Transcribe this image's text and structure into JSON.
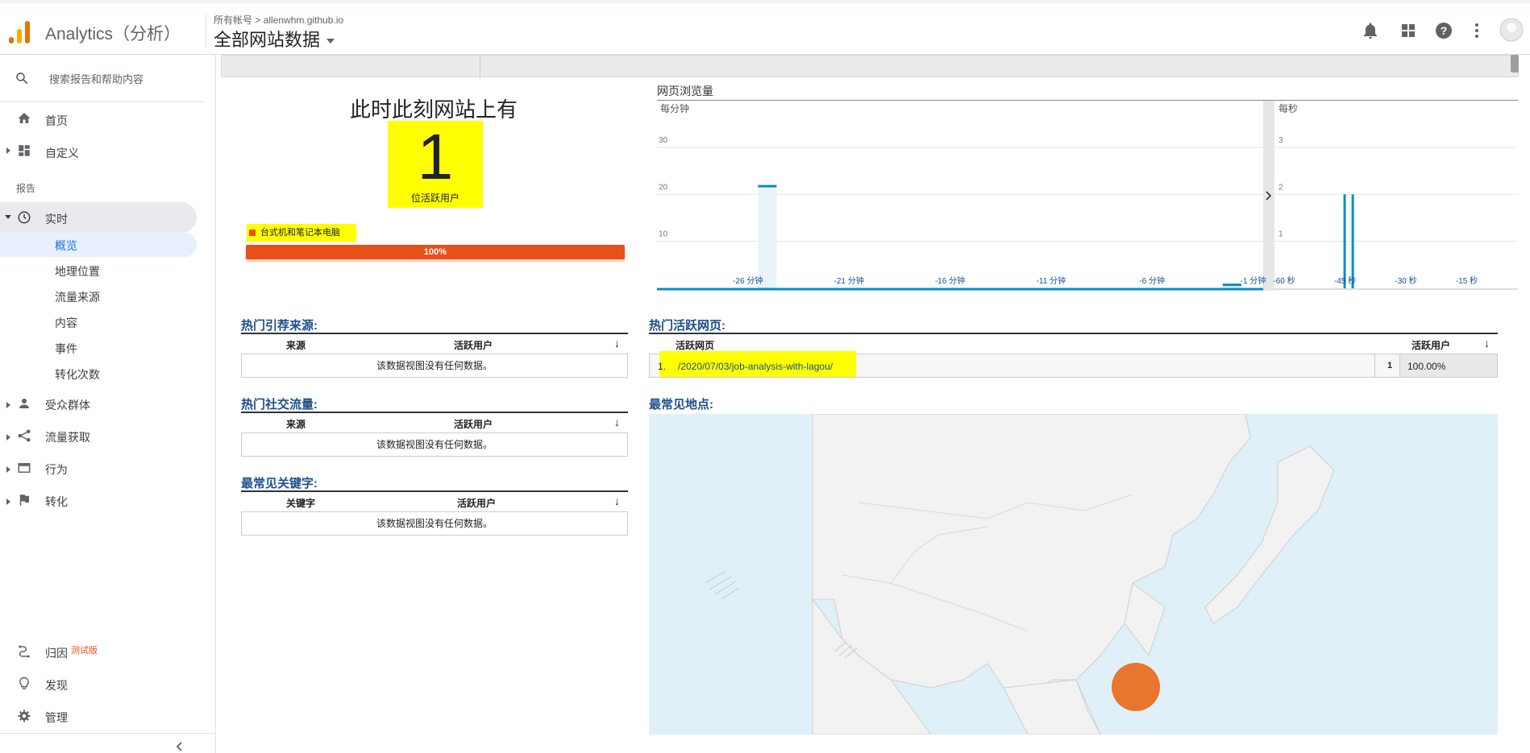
{
  "header": {
    "app_title": "Analytics（分析）",
    "breadcrumb": "所有帐号 > allenwhm.github.io",
    "property": "全部网站数据",
    "icons": [
      "bell-icon",
      "apps-icon",
      "help-icon",
      "more-vert-icon",
      "avatar"
    ]
  },
  "sidebar": {
    "search_placeholder": "搜索报告和帮助内容",
    "home": "首页",
    "customize": "自定义",
    "reports_heading": "报告",
    "realtime": "实时",
    "realtime_items": [
      "概览",
      "地理位置",
      "流量来源",
      "内容",
      "事件",
      "转化次数"
    ],
    "audience": "受众群体",
    "acquisition": "流量获取",
    "behavior": "行为",
    "conversions": "转化",
    "attribution": "归因",
    "beta_badge": "测试版",
    "discover": "发现",
    "admin": "管理",
    "collapse_icon": "chevron-left-icon"
  },
  "overview": {
    "title": "此时此刻网站上有",
    "active_count": "1",
    "active_label": "位活跃用户",
    "device_legend": "台式机和笔记本电脑",
    "device_percent": "100%",
    "device_percent_value": 100,
    "device_color": "#e8501a"
  },
  "pageviews_chart": {
    "title": "网页浏览量",
    "per_minute_label": "每分钟",
    "per_second_label": "每秒",
    "expand_icon": "chevron-right-icon"
  },
  "chart_data": [
    {
      "type": "bar",
      "title": "每分钟",
      "x_ticks": [
        "-26 分钟",
        "-21 分钟",
        "-16 分钟",
        "-11 分钟",
        "-6 分钟",
        "-1 分钟"
      ],
      "y_ticks": [
        "10",
        "20",
        "30"
      ],
      "ylim": [
        0,
        30
      ],
      "x": [
        -30,
        -29,
        -28,
        -27,
        -26,
        -25,
        -24,
        -23,
        -22,
        -21,
        -20,
        -19,
        -18,
        -17,
        -16,
        -15,
        -14,
        -13,
        -12,
        -11,
        -10,
        -9,
        -8,
        -7,
        -6,
        -5,
        -4,
        -3,
        -2,
        -1
      ],
      "values": [
        0,
        0,
        0,
        0,
        0,
        22,
        0,
        0,
        0,
        0,
        0,
        0,
        0,
        0,
        0,
        0,
        0,
        0,
        0,
        0,
        0,
        0,
        0,
        0,
        0,
        0,
        0,
        0,
        1,
        0
      ],
      "highlight_bars": [
        -25,
        -2
      ],
      "color": "#058dc7"
    },
    {
      "type": "bar",
      "title": "每秒",
      "x_ticks": [
        "-60 秒",
        "-45 秒",
        "-30 秒",
        "-15 秒"
      ],
      "y_ticks": [
        "1",
        "2",
        "3"
      ],
      "ylim": [
        0,
        3
      ],
      "bars": [
        {
          "x": -43,
          "value": 2
        },
        {
          "x": -41,
          "value": 2
        }
      ],
      "color": "#058dc7"
    }
  ],
  "referrals": {
    "title": "热门引荐来源:",
    "col_source": "来源",
    "col_users": "活跃用户",
    "empty": "该数据视图没有任何数据。"
  },
  "social": {
    "title": "热门社交流量:",
    "col_source": "来源",
    "col_users": "活跃用户",
    "empty": "该数据视图没有任何数据。"
  },
  "keywords": {
    "title": "最常见关键字:",
    "col_keyword": "关键字",
    "col_users": "活跃用户",
    "empty": "该数据视图没有任何数据。"
  },
  "active_pages": {
    "title": "热门活跃网页:",
    "col_page": "活跃网页",
    "col_users": "活跃用户",
    "rows": [
      {
        "index": "1.",
        "page": "/2020/07/03/job-analysis-with-lagou/",
        "users": "1",
        "percent": "100.00%"
      }
    ]
  },
  "locations": {
    "title": "最常见地点:",
    "marker_color": "#e8762d"
  }
}
